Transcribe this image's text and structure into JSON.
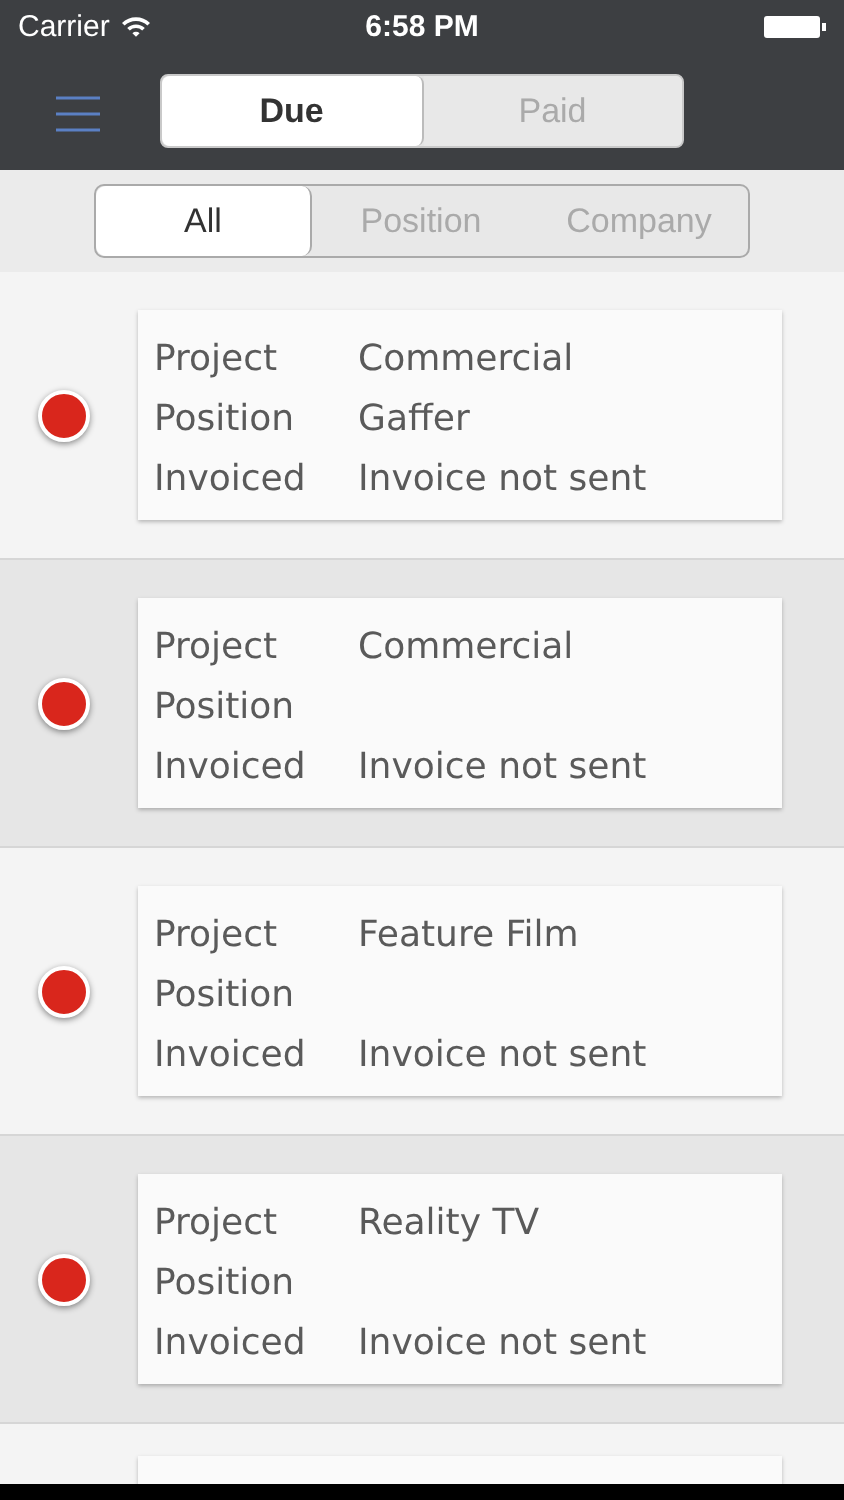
{
  "status_bar": {
    "carrier": "Carrier",
    "time": "6:58 PM"
  },
  "tabs": [
    {
      "label": "Due",
      "selected": true
    },
    {
      "label": "Paid",
      "selected": false
    }
  ],
  "filters": [
    {
      "label": "All",
      "selected": true
    },
    {
      "label": "Position",
      "selected": false
    },
    {
      "label": "Company",
      "selected": false
    }
  ],
  "rows": [
    {
      "kind": "entry",
      "color": "#d9261c",
      "fields": [
        {
          "label": "Project",
          "value": "Commercial"
        },
        {
          "label": "Position",
          "value": "Gaffer"
        },
        {
          "label": "Invoiced",
          "value": "Invoice not sent"
        }
      ]
    },
    {
      "kind": "entry",
      "color": "#d9261c",
      "fields": [
        {
          "label": "Project",
          "value": "Commercial"
        },
        {
          "label": "Position"
        },
        {
          "label": "Invoiced",
          "value": "Invoice not sent"
        }
      ]
    },
    {
      "kind": "entry",
      "color": "#d9261c",
      "fields": [
        {
          "label": "Project",
          "value": "Feature Film"
        },
        {
          "label": "Position"
        },
        {
          "label": "Invoiced",
          "value": "Invoice not sent"
        }
      ]
    },
    {
      "kind": "entry",
      "color": "#d9261c",
      "fields": [
        {
          "label": "Project",
          "value": "Reality TV"
        },
        {
          "label": "Position"
        },
        {
          "label": "Invoiced",
          "value": "Invoice not sent"
        }
      ]
    },
    {
      "kind": "clipped"
    }
  ]
}
